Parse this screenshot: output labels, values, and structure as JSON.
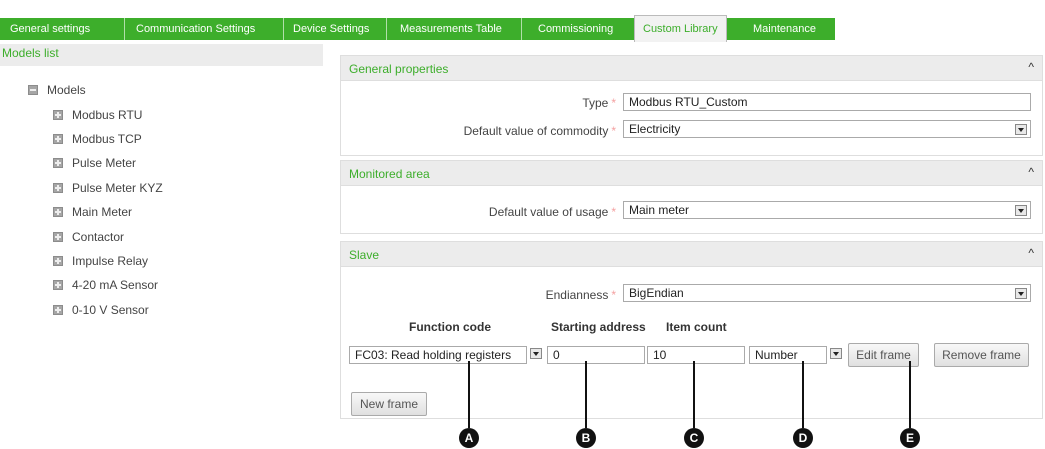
{
  "tabs": [
    {
      "label": "General settings"
    },
    {
      "label": "Communication Settings"
    },
    {
      "label": "Device Settings"
    },
    {
      "label": "Measurements Table"
    },
    {
      "label": "Commissioning"
    },
    {
      "label": "Custom Library"
    },
    {
      "label": "Maintenance"
    }
  ],
  "active_tab": "Custom Library",
  "sidebar": {
    "title": "Models list",
    "root": "Models",
    "items": [
      {
        "label": "Modbus RTU"
      },
      {
        "label": "Modbus TCP"
      },
      {
        "label": "Pulse Meter"
      },
      {
        "label": "Pulse Meter KYZ"
      },
      {
        "label": "Main Meter"
      },
      {
        "label": "Contactor"
      },
      {
        "label": "Impulse Relay"
      },
      {
        "label": "4-20 mA Sensor"
      },
      {
        "label": "0-10 V Sensor"
      }
    ]
  },
  "general_properties": {
    "title": "General properties",
    "type_label": "Type",
    "type_value": "Modbus RTU_Custom",
    "commodity_label": "Default value of commodity",
    "commodity_value": "Electricity"
  },
  "monitored_area": {
    "title": "Monitored area",
    "usage_label": "Default value of usage",
    "usage_value": "Main meter"
  },
  "slave": {
    "title": "Slave",
    "endianness_label": "Endianness",
    "endianness_value": "BigEndian",
    "col_function_code": "Function code",
    "col_starting_address": "Starting address",
    "col_item_count": "Item count",
    "function_code_value": "FC03: Read holding registers",
    "starting_address_value": "0",
    "item_count_value": "10",
    "type_value": "Number",
    "edit_frame": "Edit frame",
    "remove_frame": "Remove frame",
    "new_frame": "New frame"
  },
  "required_marker": "*",
  "collapse_glyph": "^",
  "callouts": [
    "A",
    "B",
    "C",
    "D",
    "E"
  ]
}
